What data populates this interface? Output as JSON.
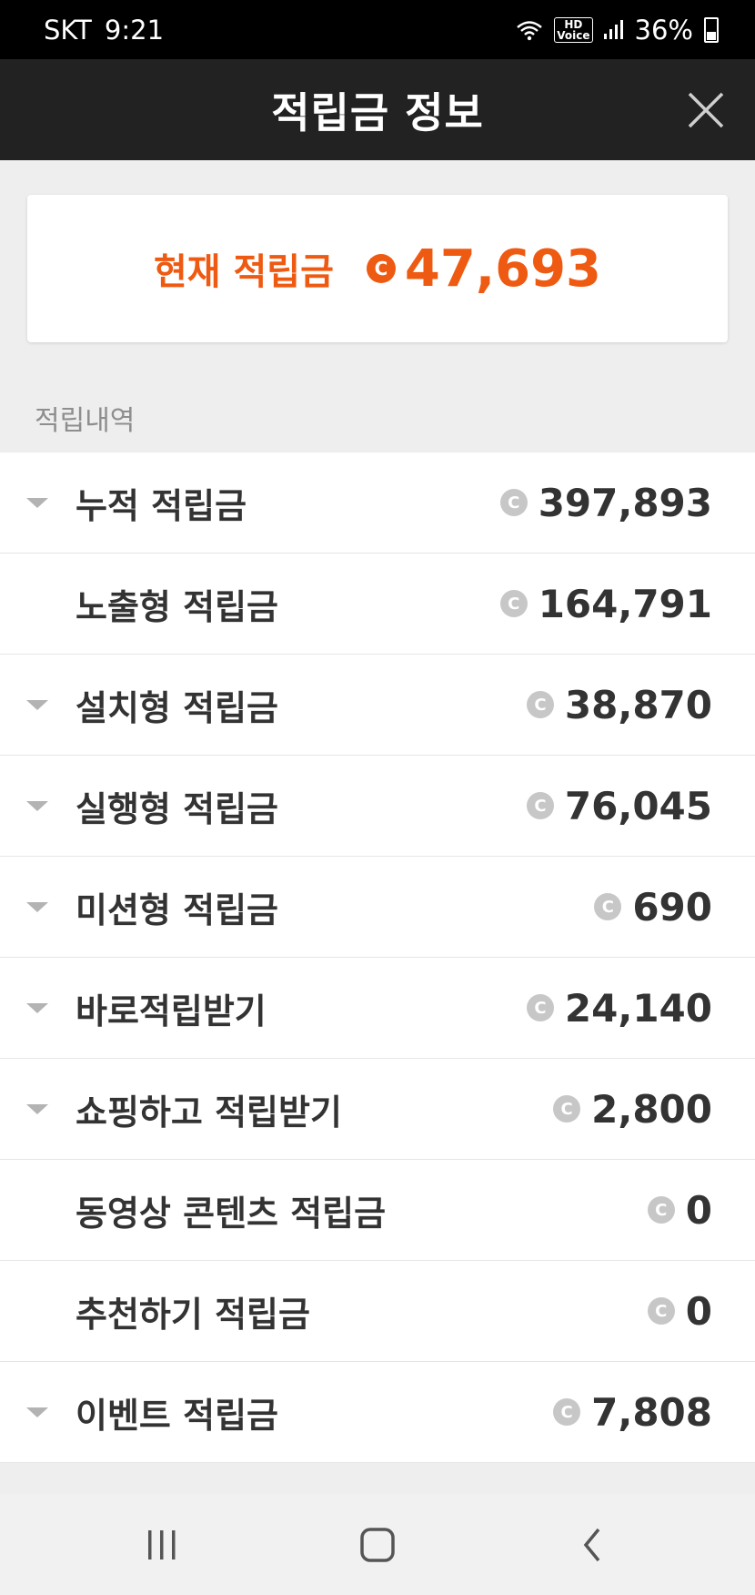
{
  "status": {
    "carrier": "SKT",
    "time": "9:21",
    "hd_voice": "HD\nVoice",
    "battery": "36%"
  },
  "header": {
    "title": "적립금 정보"
  },
  "balance": {
    "label": "현재 적립금",
    "coin": "C",
    "amount": "47,693"
  },
  "section": {
    "label": "적립내역"
  },
  "rows": [
    {
      "label": "누적 적립금",
      "value": "397,893",
      "expandable": true
    },
    {
      "label": "노출형 적립금",
      "value": "164,791",
      "expandable": false
    },
    {
      "label": "설치형 적립금",
      "value": "38,870",
      "expandable": true
    },
    {
      "label": "실행형 적립금",
      "value": "76,045",
      "expandable": true
    },
    {
      "label": "미션형 적립금",
      "value": "690",
      "expandable": true
    },
    {
      "label": "바로적립받기",
      "value": "24,140",
      "expandable": true
    },
    {
      "label": "쇼핑하고 적립받기",
      "value": "2,800",
      "expandable": true
    },
    {
      "label": "동영상 콘텐츠 적립금",
      "value": "0",
      "expandable": false
    },
    {
      "label": "추천하기 적립금",
      "value": "0",
      "expandable": false
    },
    {
      "label": "이벤트 적립금",
      "value": "7,808",
      "expandable": true
    }
  ],
  "coin_symbol": "C",
  "colors": {
    "accent": "#ee5a12",
    "header_bg": "#222222",
    "coin_gray": "#c7c7c7"
  },
  "icons": {
    "close": "close-icon",
    "wifi": "wifi-icon",
    "signal": "signal-icon",
    "battery": "battery-icon",
    "nav_recent": "recent-apps-icon",
    "nav_home": "home-icon",
    "nav_back": "back-icon"
  }
}
